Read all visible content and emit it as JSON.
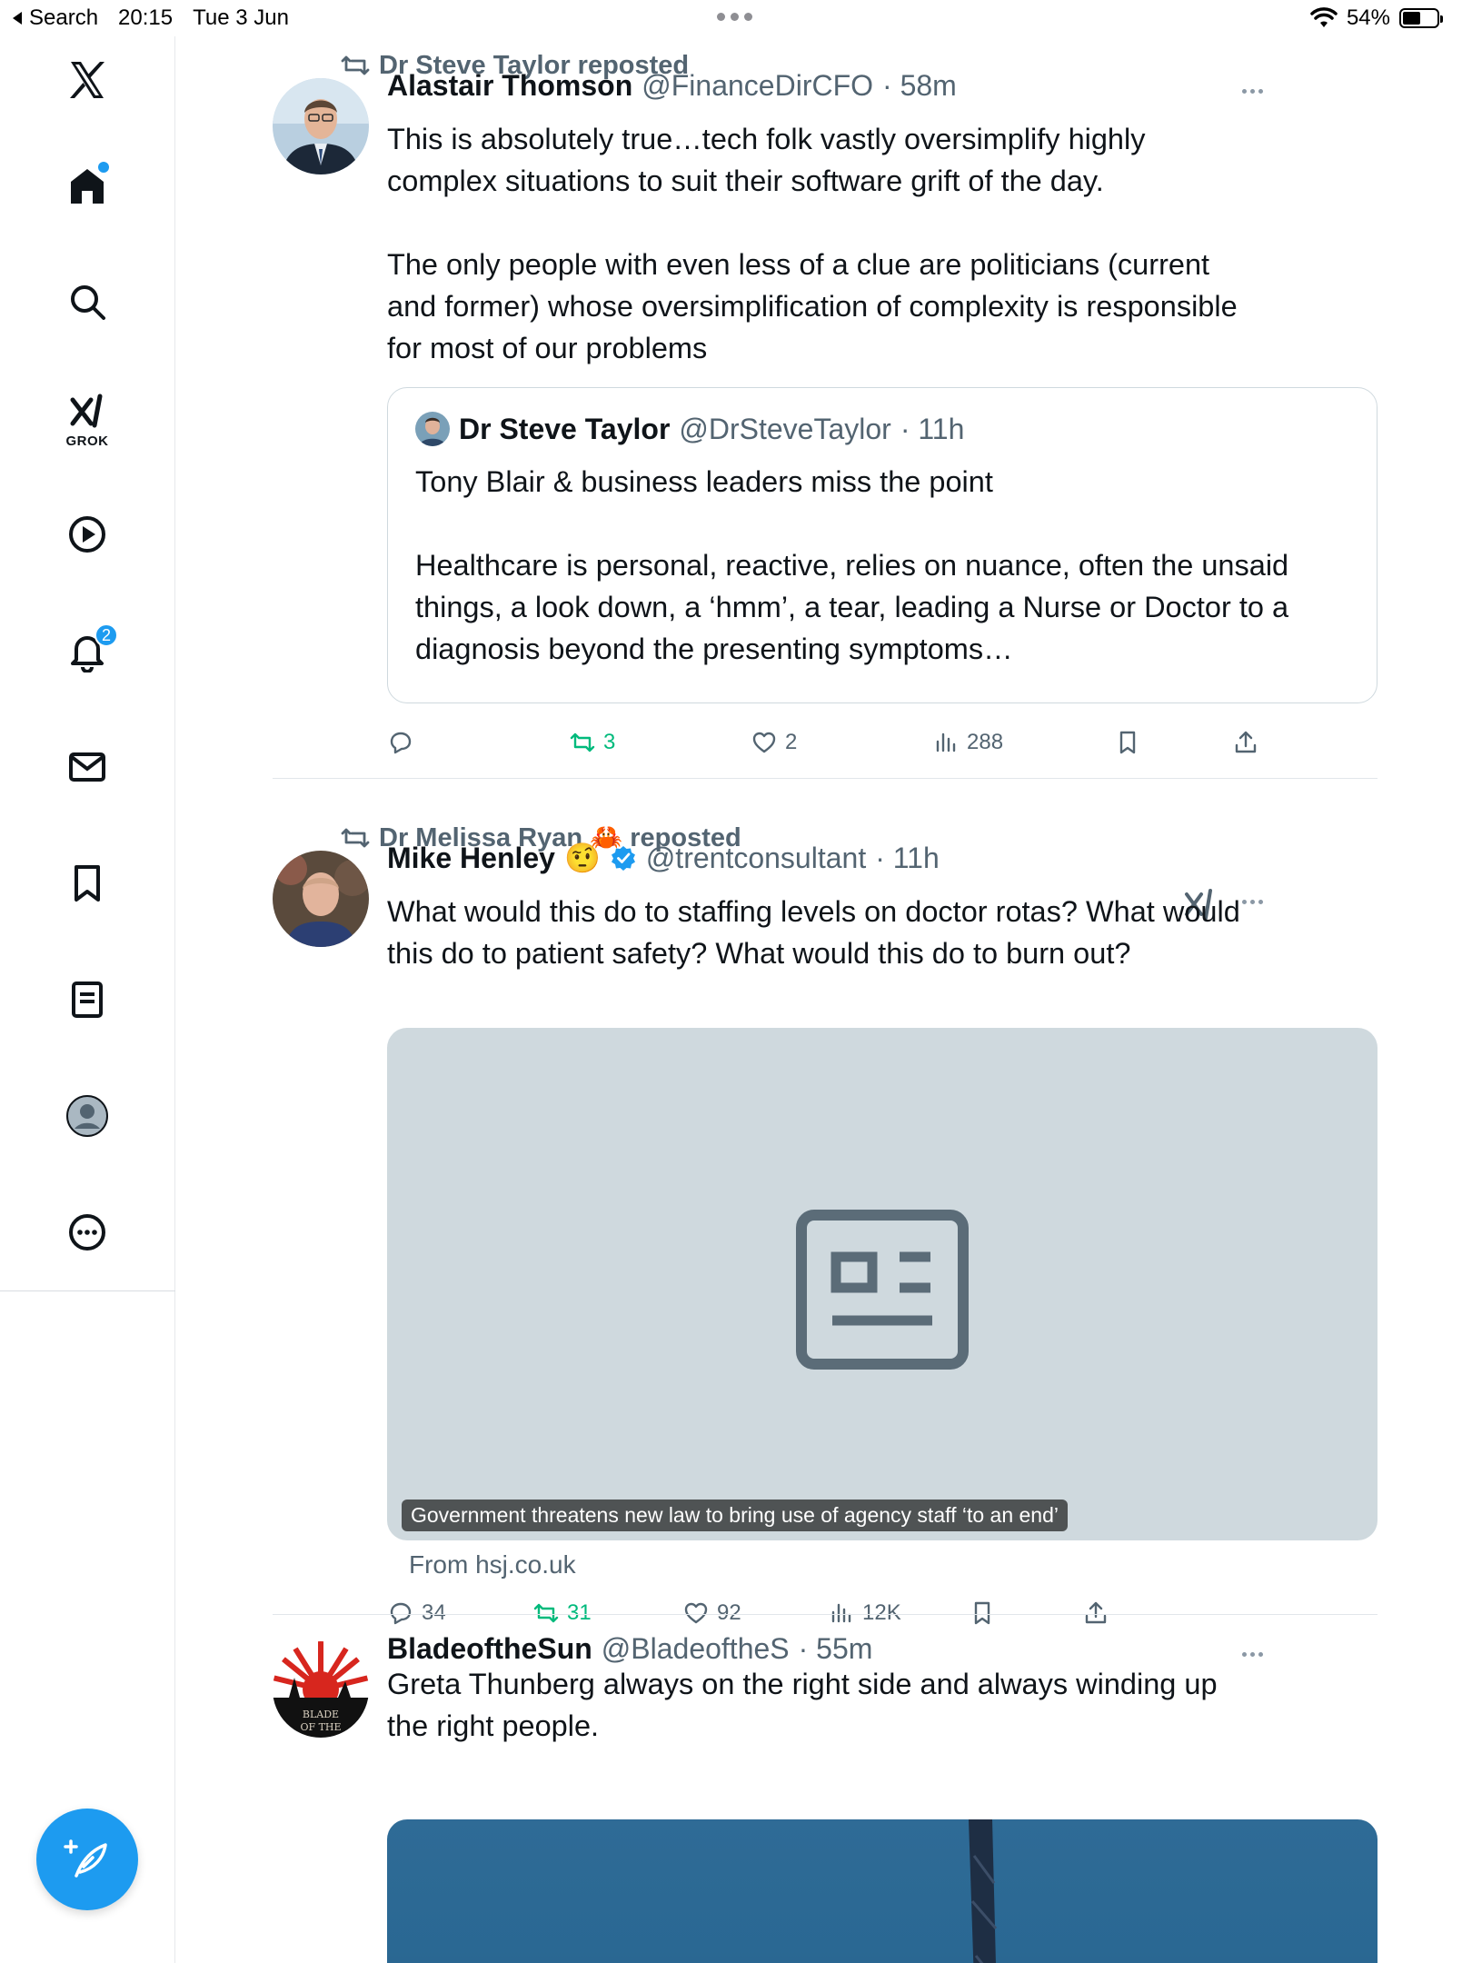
{
  "status_bar": {
    "back_label": "Search",
    "time": "20:15",
    "date": "Tue 3 Jun",
    "battery": "54%"
  },
  "sidebar": {
    "grok_label": "GROK",
    "notifications_count": "2"
  },
  "tweets": [
    {
      "repost_by": "Dr Steve Taylor reposted",
      "name": "Alastair Thomson",
      "handle": "@FinanceDirCFO",
      "time": "· 58m",
      "text": "This is absolutely true…tech folk vastly oversimplify highly complex situations to suit their software grift of the day.\n\nThe only people with even less of a clue are politicians (current and former) whose oversimplification of complexity is responsible for most of our problems",
      "quote": {
        "name": "Dr Steve Taylor",
        "handle": "@DrSteveTaylor",
        "time": "· 11h",
        "text": "Tony Blair & business leaders miss the point\n\nHealthcare is personal, reactive, relies on nuance, often the unsaid things, a look down, a ‘hmm’, a tear, leading a Nurse or Doctor to a diagnosis beyond the presenting symptoms…"
      },
      "replies": "",
      "reposts": "3",
      "likes": "2",
      "views": "288"
    },
    {
      "repost_by": "Dr Melissa Ryan 🦀 reposted",
      "name": "Mike Henley",
      "name_emoji": "🤨",
      "handle": "@trentconsultant",
      "time": "· 11h",
      "text": "What would this do to staffing levels on doctor rotas? What would this do to patient safety? What would this do to burn out?",
      "card_caption": "Government threatens new law to bring use of agency staff ‘to an end’",
      "card_source": "From hsj.co.uk",
      "replies": "34",
      "reposts": "31",
      "likes": "92",
      "views": "12K"
    },
    {
      "name": "BladeoftheSun",
      "handle": "@BladeoftheS",
      "time": "· 55m",
      "text": "Greta Thunberg always on the right side and always winding up the right people.",
      "avatar_text": "BLADE OF THE"
    }
  ],
  "colors": {
    "accent": "#1d9bf0",
    "repost_green": "#00ba7c",
    "secondary_text": "#536471",
    "card_bg": "#cfd9de"
  }
}
